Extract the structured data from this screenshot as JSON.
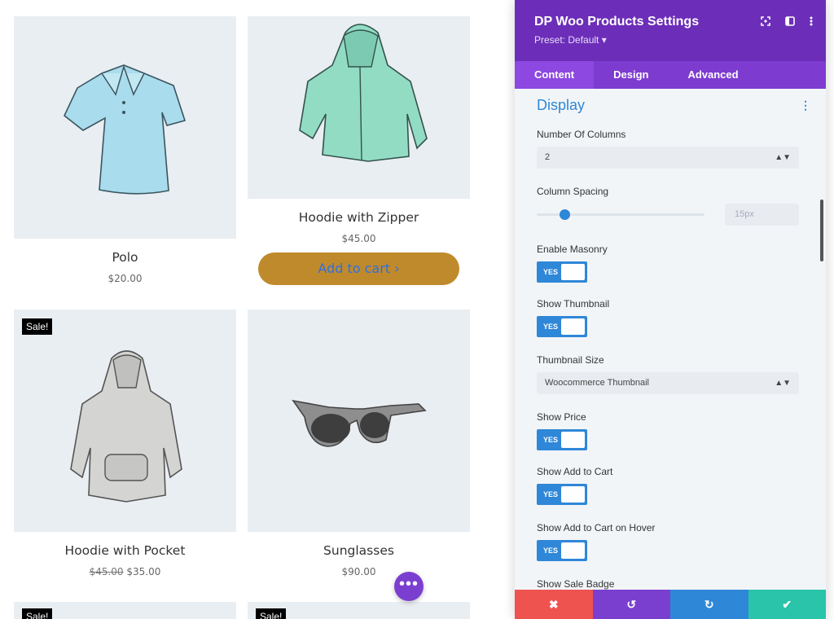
{
  "products": [
    {
      "name": "Polo",
      "price": "$20.00",
      "old_price": "",
      "sale": false,
      "add_to_cart": ""
    },
    {
      "name": "Hoodie with Zipper",
      "price": "$45.00",
      "old_price": "",
      "sale": false,
      "add_to_cart": "Add to cart ›"
    },
    {
      "name": "Hoodie with Pocket",
      "price": "$35.00",
      "old_price": "$45.00",
      "sale": true,
      "sale_label": "Sale!"
    },
    {
      "name": "Sunglasses",
      "price": "$90.00",
      "old_price": "",
      "sale": false
    },
    {
      "sale_label": "Sale!"
    },
    {
      "sale_label": "Sale!"
    }
  ],
  "fab": {
    "icon": "more-icon",
    "glyph": "•••"
  },
  "panel": {
    "title": "DP Woo Products Settings",
    "preset": "Preset: Default ▾",
    "tabs": [
      "Content",
      "Design",
      "Advanced"
    ],
    "section": "Display",
    "fields": {
      "columns": {
        "label": "Number Of Columns",
        "value": "2"
      },
      "spacing": {
        "label": "Column Spacing",
        "value": "15px"
      },
      "masonry": {
        "label": "Enable Masonry",
        "value": "YES"
      },
      "thumbnail": {
        "label": "Show Thumbnail",
        "value": "YES"
      },
      "thumb_size": {
        "label": "Thumbnail Size",
        "value": "Woocommerce Thumbnail"
      },
      "price": {
        "label": "Show Price",
        "value": "YES"
      },
      "add_cart": {
        "label": "Show Add to Cart",
        "value": "YES"
      },
      "add_cart_hover": {
        "label": "Show Add to Cart on Hover",
        "value": "YES"
      },
      "sale_badge": {
        "label": "Show Sale Badge"
      }
    },
    "footer": {
      "cancel": "✖",
      "undo": "↺",
      "redo": "↻",
      "save": "✔"
    }
  },
  "colors": {
    "accent": "#6c2eb9",
    "blue": "#2f87d8",
    "cart_button": "#bf8a2b",
    "cancel": "#ef5350",
    "undo": "#7b3fd0",
    "redo": "#2f87d8",
    "save": "#29c4a9"
  }
}
